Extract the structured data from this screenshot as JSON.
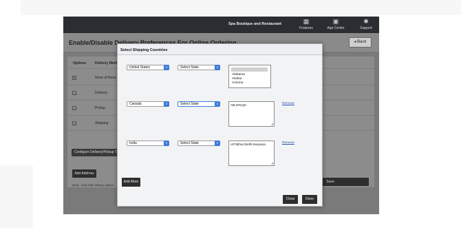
{
  "header": {
    "brand": "Spa Boutique and Restaurant",
    "nav": [
      {
        "label": "Features",
        "icon": "grid-icon"
      },
      {
        "label": "App Center",
        "icon": "app-center-icon"
      },
      {
        "label": "Support",
        "icon": "lifebuoy-icon"
      }
    ]
  },
  "page": {
    "title": "Enable/Disable Delivery Preferences For Online Ordering",
    "back_label": "◂ Back"
  },
  "table": {
    "headers": [
      "Options",
      "Delivery Meth"
    ],
    "rows": [
      {
        "label": "None of these",
        "checked": false
      },
      {
        "label": "Delivery",
        "checked": true
      },
      {
        "label": "Pickup",
        "checked": true
      },
      {
        "label": "Shipping",
        "checked": true
      }
    ],
    "configure_label": "Configure Delivery/Pickup Tim",
    "add_address_label": "Add Address",
    "note": "(Note : Only enter delivery options",
    "save_label": "Save"
  },
  "modal": {
    "title": "Select Shipping Countries",
    "rows": [
      {
        "country": "United States",
        "state": "Select State",
        "states_list": [
          "Alabama",
          "Alaska",
          "Arizona"
        ],
        "remove_label": ""
      },
      {
        "country": "Canada",
        "state": "Select State",
        "textarea": "AB;ON;QC",
        "remove_label": "Remove"
      },
      {
        "country": "India",
        "state": "Select State",
        "textarea": "UP;Bihar;Delhi;Haryana",
        "remove_label": "Remove"
      }
    ],
    "add_more_label": "Add More",
    "close_label": "Close",
    "done_label": "Done"
  },
  "colors": {
    "header_bg": "#2a2e33",
    "dropdown_arrow": "#3c7bd6",
    "link": "#2a4db8",
    "button_dark": "#2e2e2e"
  }
}
